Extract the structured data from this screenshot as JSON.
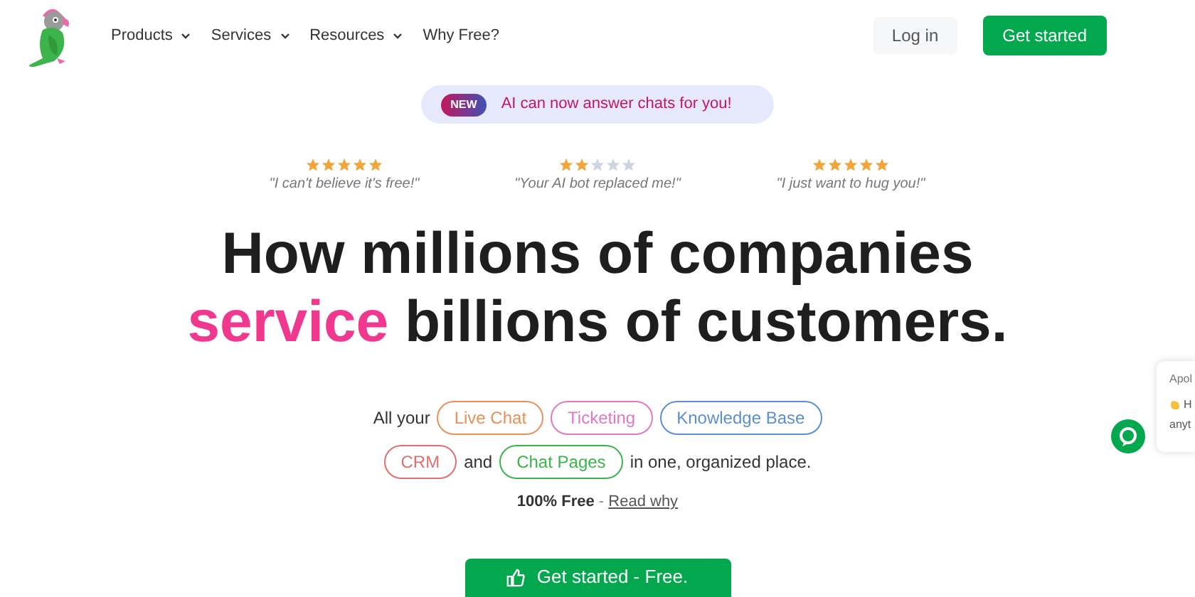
{
  "nav": {
    "items": [
      {
        "label": "Products",
        "dropdown": true
      },
      {
        "label": "Services",
        "dropdown": true
      },
      {
        "label": "Resources",
        "dropdown": true
      },
      {
        "label": "Why Free?",
        "dropdown": false
      }
    ],
    "login": "Log in",
    "cta": "Get started"
  },
  "announcement": {
    "badge": "NEW",
    "text": "AI can now answer chats for you!"
  },
  "reviews": [
    {
      "stars": 5,
      "quote": "\"I can't believe it's free!\""
    },
    {
      "stars": 2,
      "quote": "\"Your AI bot replaced me!\""
    },
    {
      "stars": 5,
      "quote": "\"I just want to hug you!\""
    }
  ],
  "headline": {
    "line_1": "How millions of companies",
    "highlight": "service",
    "line_2_rest": "billions of customers."
  },
  "features": {
    "lead": "All your",
    "joiner": "and",
    "tail": "in one, organized place.",
    "tags": [
      {
        "label": "Live Chat",
        "color": "#e8915a"
      },
      {
        "label": "Ticketing",
        "color": "#e07ac0"
      },
      {
        "label": "Knowledge Base",
        "color": "#5b8fd0"
      },
      {
        "label": "CRM",
        "color": "#e07070"
      },
      {
        "label": "Chat Pages",
        "color": "#3cb44b"
      }
    ]
  },
  "free_note": {
    "bold": "100% Free",
    "separator": " - ",
    "link": "Read why"
  },
  "main_cta": "Get started - Free.",
  "chat_preview": {
    "sender": "Apol",
    "line_1": "H",
    "line_2": "anyt"
  }
}
